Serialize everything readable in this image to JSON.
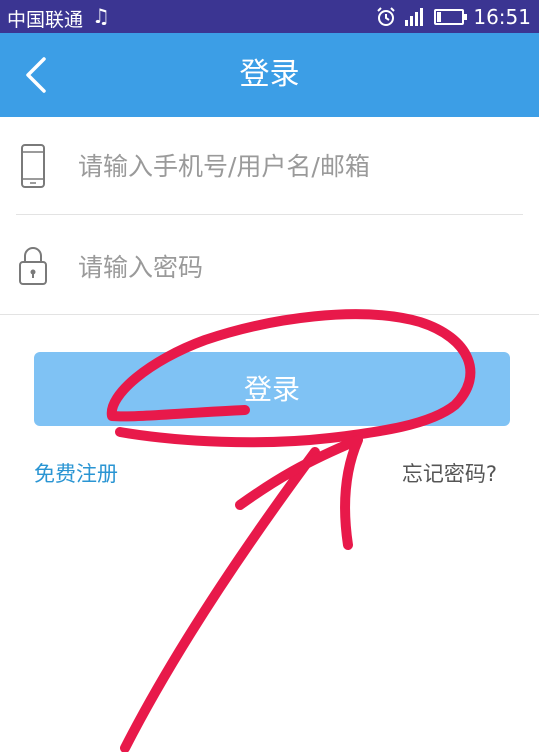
{
  "status_bar": {
    "carrier": "中国联通",
    "time": "16:51",
    "battery_level": 0.15,
    "icons": [
      "music-note-icon",
      "alarm-clock-icon",
      "signal-icon",
      "battery-icon"
    ]
  },
  "header": {
    "title": "登录",
    "back_icon": "chevron-left-icon",
    "background": "#3c9ee6"
  },
  "form": {
    "username": {
      "placeholder": "请输入手机号/用户名/邮箱",
      "value": "",
      "icon": "phone-icon"
    },
    "password": {
      "placeholder": "请输入密码",
      "value": "",
      "icon": "lock-icon"
    },
    "login_label": "登录",
    "login_color": "#7fc2f4"
  },
  "links": {
    "register": "免费注册",
    "forgot": "忘记密码?"
  },
  "annotation": {
    "color": "#e8194a",
    "shapes": [
      "circle-around-login-button",
      "arrow-pointing-to-login-button"
    ]
  }
}
